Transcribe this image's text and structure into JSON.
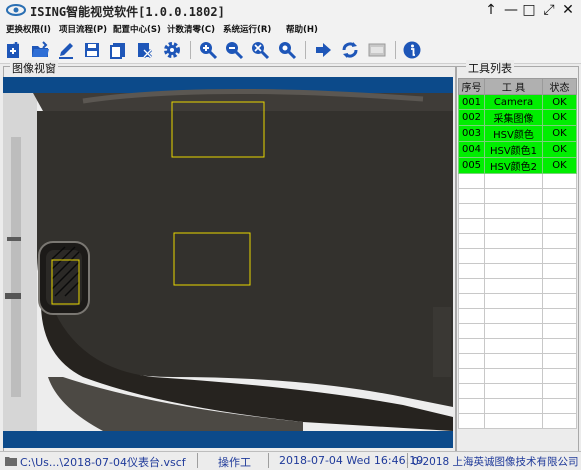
{
  "window": {
    "title": "ISING智能视觉软件[1.0.0.1802]"
  },
  "menu": [
    "更换权限(I)",
    "项目流程(P)",
    "配置中心(S)",
    "计数清零(C)",
    "系统运行(R)",
    "帮助(H)"
  ],
  "toolbar": {
    "buttons": [
      "new-icon",
      "open-icon",
      "edit-icon",
      "save-icon",
      "save-as-icon",
      "delete-icon",
      "settings-icon",
      "zoom-in-icon",
      "zoom-out-icon",
      "zoom-fit-icon",
      "zoom-actual-icon",
      "run-icon",
      "refresh-icon",
      "grab-frame-icon",
      "info-icon"
    ]
  },
  "image_view": {
    "title": "图像视窗"
  },
  "tool_list": {
    "title": "工具列表",
    "columns": [
      "序号",
      "工 具",
      "状态"
    ],
    "rows": [
      {
        "id": "001",
        "tool": "Camera",
        "status": "OK"
      },
      {
        "id": "002",
        "tool": "采集图像",
        "status": "OK"
      },
      {
        "id": "003",
        "tool": "HSV颜色",
        "status": "OK"
      },
      {
        "id": "004",
        "tool": "HSV颜色1",
        "status": "OK"
      },
      {
        "id": "005",
        "tool": "HSV颜色2",
        "status": "OK"
      }
    ],
    "empty_rows": 17,
    "row_ok_color": "#00ee00"
  },
  "status_bar": {
    "file": "C:\\Us...\\2018-07-04仪表台.vscf",
    "user": "操作工",
    "datetime": "2018-07-04 Wed 16:46:19",
    "copyright": "0-2018 上海英诚图像技术有限公司"
  },
  "colors": {
    "canvas_bg": "#0c4a8a",
    "roi_stroke": "#e8d600",
    "status_text": "#1f3a9a"
  }
}
